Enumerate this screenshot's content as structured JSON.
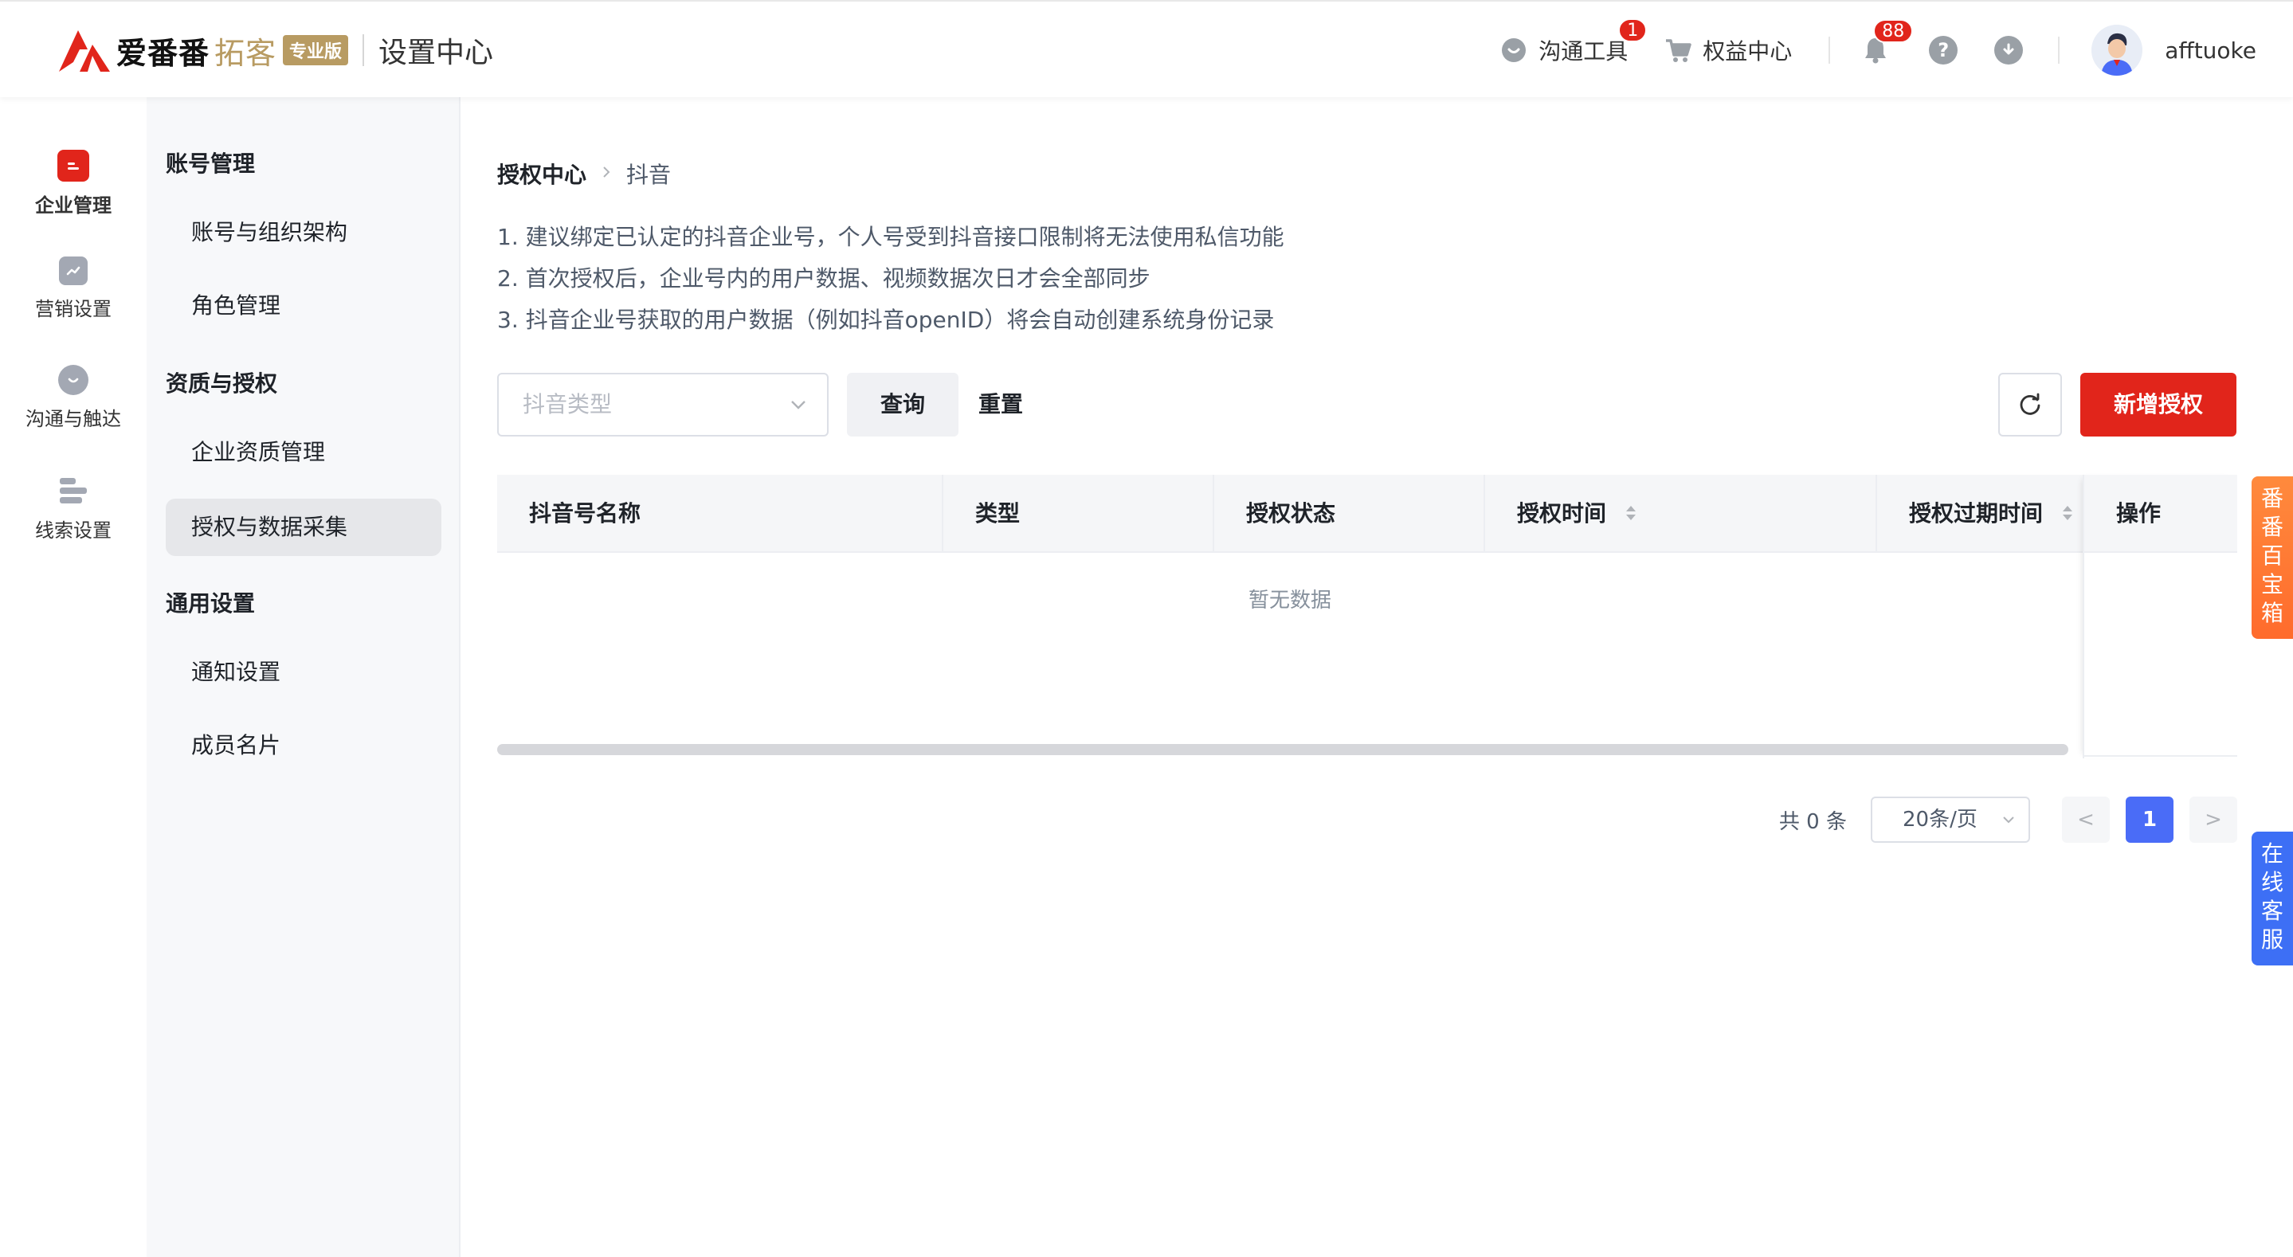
{
  "header": {
    "brand_name": "爱番番",
    "brand_sub": "拓客",
    "brand_badge": "专业版",
    "page_title": "设置中心",
    "tools": [
      {
        "label": "沟通工具",
        "icon": "chat-icon",
        "badge": "1"
      },
      {
        "label": "权益中心",
        "icon": "cart-icon"
      }
    ],
    "notify_badge": "88",
    "help_icon": "?",
    "download_icon": "download-icon",
    "username": "afftuoke"
  },
  "rail": {
    "items": [
      {
        "label": "企业管理",
        "icon": "enterprise-icon",
        "active": true
      },
      {
        "label": "营销设置",
        "icon": "chart-icon"
      },
      {
        "label": "沟通与触达",
        "icon": "chat-icon"
      },
      {
        "label": "线索设置",
        "icon": "list-icon"
      }
    ]
  },
  "submenu": {
    "groups": [
      {
        "title": "账号管理",
        "items": [
          "账号与组织架构",
          "角色管理"
        ]
      },
      {
        "title": "资质与授权",
        "items": [
          "企业资质管理",
          "授权与数据采集"
        ]
      },
      {
        "title": "通用设置",
        "items": [
          "通知设置",
          "成员名片"
        ]
      }
    ],
    "active_item": "授权与数据采集"
  },
  "main": {
    "breadcrumb": {
      "parent": "授权中心",
      "separator": ">",
      "current": "抖音"
    },
    "tips": [
      "1. 建议绑定已认定的抖音企业号，个人号受到抖音接口限制将无法使用私信功能",
      "2. 首次授权后，企业号内的用户数据、视频数据次日才会全部同步",
      "3. 抖音企业号获取的用户数据（例如抖音openID）将会自动创建系统身份记录"
    ],
    "filter": {
      "placeholder": "抖音类型"
    },
    "query_label": "查询",
    "reset_label": "重置",
    "new_label": "新增授权",
    "table": {
      "columns": [
        "抖音号名称",
        "类型",
        "授权状态",
        "授权时间",
        "授权过期时间",
        "操作"
      ],
      "empty_text": "暂无数据"
    },
    "pagination": {
      "total": "共 0 条",
      "page_size": "20条/页",
      "current_page": "1",
      "prev": "<",
      "next": ">"
    }
  },
  "floating": {
    "toolbox": [
      "番",
      "番",
      "百",
      "宝",
      "箱"
    ],
    "service": [
      "在",
      "线",
      "客",
      "服"
    ]
  },
  "colors": {
    "brand_red": "#e1251b",
    "brand_gold": "#b89b62",
    "pager_blue": "#4a6cf7",
    "toolbox_orange": "#ff7a35",
    "service_blue": "#3d6ff5"
  }
}
